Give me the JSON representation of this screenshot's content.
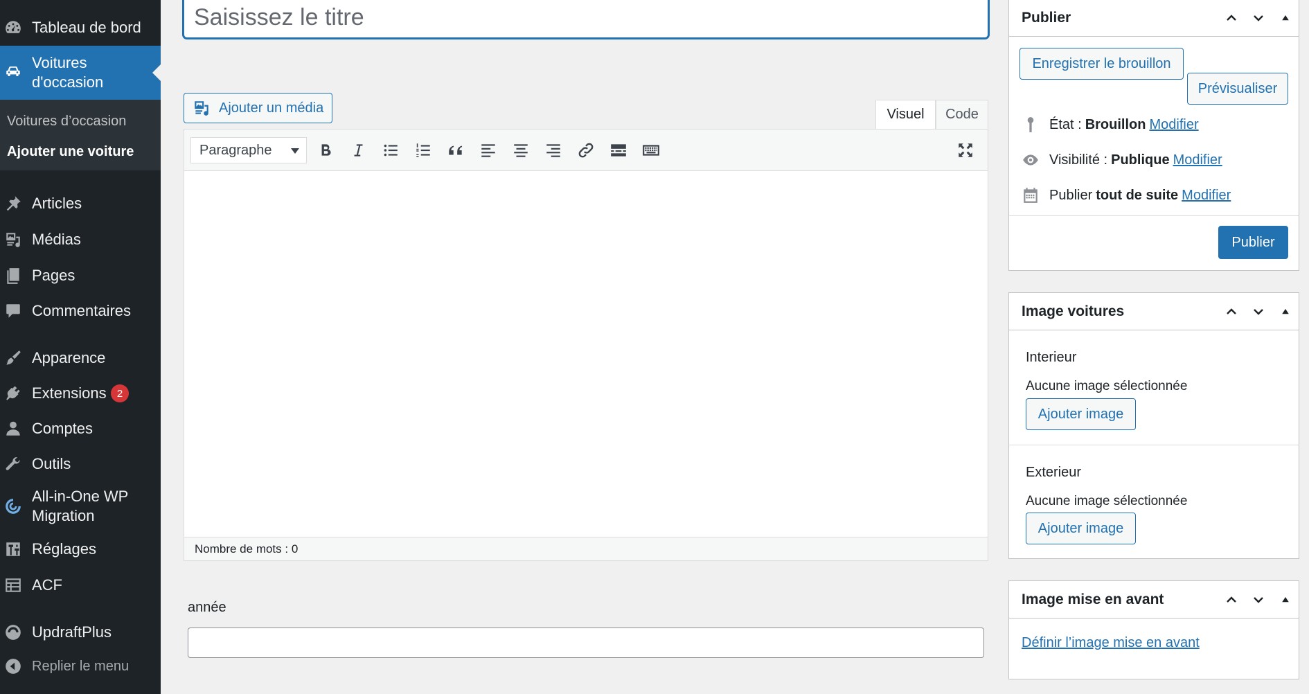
{
  "sidebar": {
    "items": [
      {
        "label": "Tableau de bord",
        "icon": "dashboard-icon"
      },
      {
        "label": "Voitures\nd'occasion",
        "icon": "car-icon",
        "current": true
      },
      {
        "label": "Articles",
        "icon": "pin-icon"
      },
      {
        "label": "Médias",
        "icon": "media-icon"
      },
      {
        "label": "Pages",
        "icon": "pages-icon"
      },
      {
        "label": "Commentaires",
        "icon": "comments-icon"
      },
      {
        "label": "Apparence",
        "icon": "appearance-icon"
      },
      {
        "label": "Extensions",
        "icon": "plugins-icon",
        "badge": "2"
      },
      {
        "label": "Comptes",
        "icon": "users-icon"
      },
      {
        "label": "Outils",
        "icon": "tools-icon"
      },
      {
        "label": "All-in-One WP\nMigration",
        "icon": "migration-icon"
      },
      {
        "label": "Réglages",
        "icon": "settings-icon"
      },
      {
        "label": "ACF",
        "icon": "acf-icon"
      },
      {
        "label": "UpdraftPlus",
        "icon": "updraft-icon"
      },
      {
        "label": "Replier le menu",
        "icon": "collapse-icon"
      }
    ],
    "submenu": [
      {
        "label": "Voitures d’occasion"
      },
      {
        "label": "Ajouter une voiture",
        "active": true
      }
    ]
  },
  "editor": {
    "title_placeholder": "Saisissez le titre",
    "add_media": "Ajouter un média",
    "tab_visual": "Visuel",
    "tab_code": "Code",
    "format_select": "Paragraphe",
    "word_count": "Nombre de mots : 0"
  },
  "fields": {
    "annee_label": "année",
    "annee_value": ""
  },
  "publish_box": {
    "title": "Publier",
    "save_draft": "Enregistrer le brouillon",
    "preview": "Prévisualiser",
    "status_label": "État :",
    "status_value": "Brouillon",
    "visibility_label": "Visibilité :",
    "visibility_value": "Publique",
    "publish_label": "Publier",
    "publish_value": "tout de suite",
    "modify": "Modifier",
    "publish_button": "Publier"
  },
  "images_box": {
    "title": "Image voitures",
    "interior_label": "Interieur",
    "interior_note": "Aucune image sélectionnée",
    "exterior_label": "Exterieur",
    "exterior_note": "Aucune image sélectionnée",
    "add_image": "Ajouter image"
  },
  "featured_box": {
    "title": "Image mise en avant",
    "set_link": "Définir l’image mise en avant"
  },
  "colors": {
    "accent": "#2271b1",
    "sidebar_bg": "#1d2327",
    "badge": "#d63638"
  }
}
